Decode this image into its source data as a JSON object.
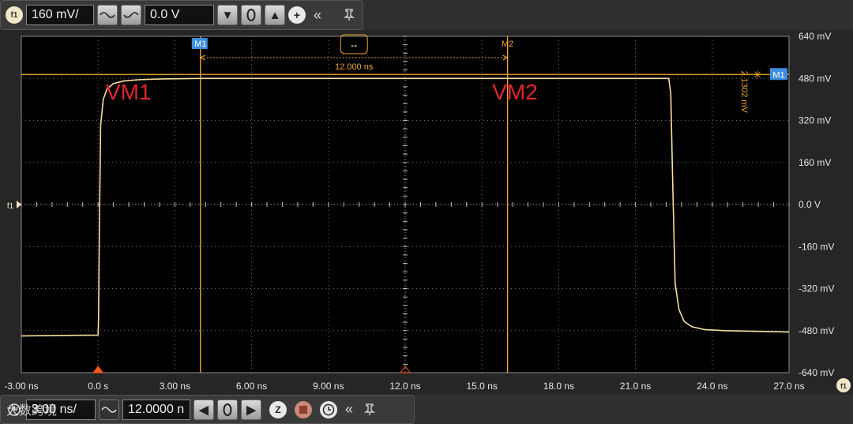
{
  "top_toolbar": {
    "channel_badge": "f1",
    "scale_value": "160 mV/",
    "offset_value": "0.0 V",
    "icons": [
      "wave-icon",
      "wave-icon",
      "chevron-down-icon",
      "zero-icon",
      "chevron-up-icon",
      "add-icon",
      "collapse-icon",
      "pin-icon"
    ]
  },
  "bottom_toolbar": {
    "timebase_value": "3.00 ns/",
    "position_value": "12.0000 n",
    "watermark": "大数跨境",
    "icons": [
      "clock-icon",
      "wave-icon",
      "chevron-left-icon",
      "zero-icon",
      "chevron-right-icon",
      "zoom-icon",
      "stop-icon",
      "clock-icon",
      "collapse-icon",
      "pin-icon"
    ]
  },
  "colors": {
    "trace": "#f5dfa0",
    "marker": "#f0a52f",
    "label": "#e0262a",
    "grid": "#6a6a6a",
    "background": "#000000",
    "marker_flag": "#3d8ee0"
  },
  "chart_data": {
    "type": "line",
    "xlim": [
      -3.0,
      27.0
    ],
    "ylim": [
      -640,
      640
    ],
    "x_unit": "ns",
    "y_unit": "mV",
    "x_ticks": [
      -3,
      0,
      3,
      6,
      9,
      12,
      15,
      18,
      21,
      24,
      27
    ],
    "x_tick_labels": [
      "-3.00 ns",
      "0.0 s",
      "3.00 ns",
      "6.00 ns",
      "9.00 ns",
      "12.0 ns",
      "15.0 ns",
      "18.0 ns",
      "21.0 ns",
      "24.0 ns",
      "27.0 ns"
    ],
    "y_ticks": [
      640,
      480,
      320,
      160,
      0,
      -160,
      -320,
      -480,
      -640
    ],
    "y_tick_labels": [
      "640 mV",
      "480 mV",
      "320 mV",
      "160 mV",
      "0.0 V",
      "-160 mV",
      "-320 mV",
      "-480 mV",
      "-640 mV"
    ],
    "grid": true,
    "series": [
      {
        "x": [
          -3.0,
          -1.0,
          0.0,
          0.02,
          0.05,
          0.1,
          0.2,
          0.35,
          0.6,
          1.0,
          1.6,
          2.5,
          4.0,
          8.0,
          12.0,
          16.0,
          20.0,
          22.3,
          22.38,
          22.45,
          22.55,
          22.7,
          22.9,
          23.2,
          23.7,
          24.5,
          27.0
        ],
        "y": [
          -500,
          -498,
          -497,
          -430,
          -100,
          300,
          400,
          440,
          460,
          470,
          475,
          478,
          480,
          480,
          480,
          480,
          480,
          480,
          420,
          100,
          -300,
          -400,
          -445,
          -465,
          -476,
          -480,
          -485
        ]
      }
    ],
    "markers": [
      {
        "label": "M1",
        "x": 4.0
      },
      {
        "label": "M2",
        "x": 16.0
      }
    ],
    "horizontal_marker": {
      "label": "M1",
      "y": 495
    },
    "delta_time_label": "12.000 ns",
    "delta_voltage_label": "2.1302 mV",
    "trigger_level_label": "f1",
    "annotations": [
      {
        "text": "VM1",
        "x": 0.3,
        "y": 400
      },
      {
        "text": "VM2",
        "x": 15.4,
        "y": 400
      }
    ],
    "corner_badge": "f1"
  }
}
